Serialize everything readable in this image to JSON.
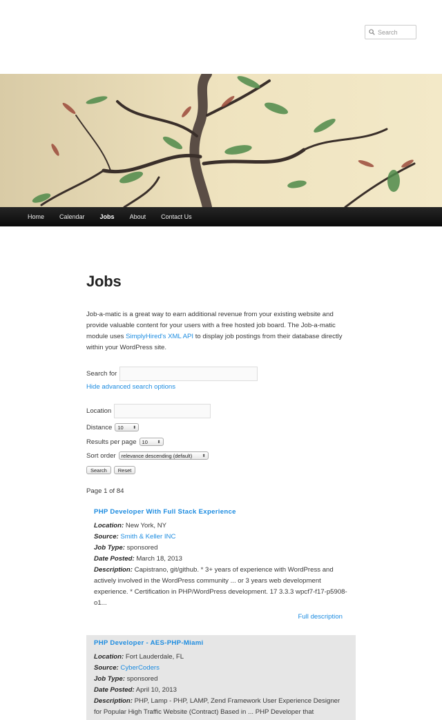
{
  "search": {
    "placeholder": "Search"
  },
  "nav": {
    "items": [
      {
        "label": "Home"
      },
      {
        "label": "Calendar"
      },
      {
        "label": "Jobs"
      },
      {
        "label": "About"
      },
      {
        "label": "Contact Us"
      }
    ]
  },
  "page": {
    "title": "Jobs",
    "intro_before": "Job-a-matic is a great way to earn additional revenue from your existing website and provide valuable content for your users with a free hosted job board. The Job-a-matic module uses ",
    "intro_link": "SimplyHired's XML API",
    "intro_after": " to display job postings from their database directly within your WordPress site."
  },
  "form": {
    "search_for_label": "Search for",
    "search_for_value": "",
    "hide_advanced": "Hide advanced search options",
    "location_label": "Location",
    "location_value": "",
    "distance_label": "Distance",
    "distance_value": "10",
    "results_label": "Results per page",
    "results_value": "10",
    "sort_label": "Sort order",
    "sort_value": "relevance descending (default)",
    "search_button": "Search",
    "reset_button": "Reset"
  },
  "pagination": {
    "text": "Page 1 of 84"
  },
  "jobs": [
    {
      "title": "PHP Developer With Full Stack Experience",
      "location_label": "Location:",
      "location": "New York, NY",
      "source_label": "Source:",
      "source": "Smith & Keller INC",
      "type_label": "Job Type:",
      "type": "sponsored",
      "date_label": "Date Posted:",
      "date": "March 18, 2013",
      "desc_label": "Description:",
      "description": "Capistrano, git/github. * 3+ years of experience with WordPress and actively involved in the WordPress community ... or 3 years web development experience. * Certification in PHP/WordPress development. 17 3.3.3 wpcf7-f17-p5908-o1...",
      "full_desc": "Full description"
    },
    {
      "title": "PHP Developer - AES-PHP-Miami",
      "location_label": "Location:",
      "location": "Fort Lauderdale, FL",
      "source_label": "Source:",
      "source": "CyberCoders",
      "type_label": "Job Type:",
      "type": "sponsored",
      "date_label": "Date Posted:",
      "date": "April 10, 2013",
      "desc_label": "Description:",
      "description": "PHP, Lamp - PHP, LAMP, Zend Framework User Experience Designer for Popular High Traffic Website (Contract) Based in ... PHP Developer that"
    }
  ],
  "colors": {
    "link": "#1b8be0",
    "nav_bg": "#111111",
    "alt_row": "#e6e6e6"
  }
}
